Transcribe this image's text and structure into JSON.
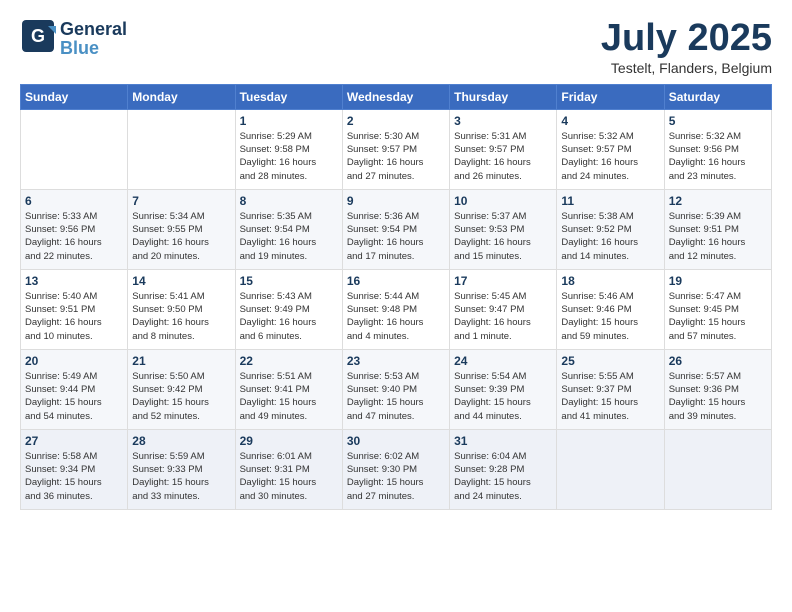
{
  "header": {
    "logo_line1": "General",
    "logo_line2": "Blue",
    "month": "July 2025",
    "location": "Testelt, Flanders, Belgium"
  },
  "weekdays": [
    "Sunday",
    "Monday",
    "Tuesday",
    "Wednesday",
    "Thursday",
    "Friday",
    "Saturday"
  ],
  "weeks": [
    [
      {
        "day": "",
        "info": ""
      },
      {
        "day": "",
        "info": ""
      },
      {
        "day": "1",
        "info": "Sunrise: 5:29 AM\nSunset: 9:58 PM\nDaylight: 16 hours\nand 28 minutes."
      },
      {
        "day": "2",
        "info": "Sunrise: 5:30 AM\nSunset: 9:57 PM\nDaylight: 16 hours\nand 27 minutes."
      },
      {
        "day": "3",
        "info": "Sunrise: 5:31 AM\nSunset: 9:57 PM\nDaylight: 16 hours\nand 26 minutes."
      },
      {
        "day": "4",
        "info": "Sunrise: 5:32 AM\nSunset: 9:57 PM\nDaylight: 16 hours\nand 24 minutes."
      },
      {
        "day": "5",
        "info": "Sunrise: 5:32 AM\nSunset: 9:56 PM\nDaylight: 16 hours\nand 23 minutes."
      }
    ],
    [
      {
        "day": "6",
        "info": "Sunrise: 5:33 AM\nSunset: 9:56 PM\nDaylight: 16 hours\nand 22 minutes."
      },
      {
        "day": "7",
        "info": "Sunrise: 5:34 AM\nSunset: 9:55 PM\nDaylight: 16 hours\nand 20 minutes."
      },
      {
        "day": "8",
        "info": "Sunrise: 5:35 AM\nSunset: 9:54 PM\nDaylight: 16 hours\nand 19 minutes."
      },
      {
        "day": "9",
        "info": "Sunrise: 5:36 AM\nSunset: 9:54 PM\nDaylight: 16 hours\nand 17 minutes."
      },
      {
        "day": "10",
        "info": "Sunrise: 5:37 AM\nSunset: 9:53 PM\nDaylight: 16 hours\nand 15 minutes."
      },
      {
        "day": "11",
        "info": "Sunrise: 5:38 AM\nSunset: 9:52 PM\nDaylight: 16 hours\nand 14 minutes."
      },
      {
        "day": "12",
        "info": "Sunrise: 5:39 AM\nSunset: 9:51 PM\nDaylight: 16 hours\nand 12 minutes."
      }
    ],
    [
      {
        "day": "13",
        "info": "Sunrise: 5:40 AM\nSunset: 9:51 PM\nDaylight: 16 hours\nand 10 minutes."
      },
      {
        "day": "14",
        "info": "Sunrise: 5:41 AM\nSunset: 9:50 PM\nDaylight: 16 hours\nand 8 minutes."
      },
      {
        "day": "15",
        "info": "Sunrise: 5:43 AM\nSunset: 9:49 PM\nDaylight: 16 hours\nand 6 minutes."
      },
      {
        "day": "16",
        "info": "Sunrise: 5:44 AM\nSunset: 9:48 PM\nDaylight: 16 hours\nand 4 minutes."
      },
      {
        "day": "17",
        "info": "Sunrise: 5:45 AM\nSunset: 9:47 PM\nDaylight: 16 hours\nand 1 minute."
      },
      {
        "day": "18",
        "info": "Sunrise: 5:46 AM\nSunset: 9:46 PM\nDaylight: 15 hours\nand 59 minutes."
      },
      {
        "day": "19",
        "info": "Sunrise: 5:47 AM\nSunset: 9:45 PM\nDaylight: 15 hours\nand 57 minutes."
      }
    ],
    [
      {
        "day": "20",
        "info": "Sunrise: 5:49 AM\nSunset: 9:44 PM\nDaylight: 15 hours\nand 54 minutes."
      },
      {
        "day": "21",
        "info": "Sunrise: 5:50 AM\nSunset: 9:42 PM\nDaylight: 15 hours\nand 52 minutes."
      },
      {
        "day": "22",
        "info": "Sunrise: 5:51 AM\nSunset: 9:41 PM\nDaylight: 15 hours\nand 49 minutes."
      },
      {
        "day": "23",
        "info": "Sunrise: 5:53 AM\nSunset: 9:40 PM\nDaylight: 15 hours\nand 47 minutes."
      },
      {
        "day": "24",
        "info": "Sunrise: 5:54 AM\nSunset: 9:39 PM\nDaylight: 15 hours\nand 44 minutes."
      },
      {
        "day": "25",
        "info": "Sunrise: 5:55 AM\nSunset: 9:37 PM\nDaylight: 15 hours\nand 41 minutes."
      },
      {
        "day": "26",
        "info": "Sunrise: 5:57 AM\nSunset: 9:36 PM\nDaylight: 15 hours\nand 39 minutes."
      }
    ],
    [
      {
        "day": "27",
        "info": "Sunrise: 5:58 AM\nSunset: 9:34 PM\nDaylight: 15 hours\nand 36 minutes."
      },
      {
        "day": "28",
        "info": "Sunrise: 5:59 AM\nSunset: 9:33 PM\nDaylight: 15 hours\nand 33 minutes."
      },
      {
        "day": "29",
        "info": "Sunrise: 6:01 AM\nSunset: 9:31 PM\nDaylight: 15 hours\nand 30 minutes."
      },
      {
        "day": "30",
        "info": "Sunrise: 6:02 AM\nSunset: 9:30 PM\nDaylight: 15 hours\nand 27 minutes."
      },
      {
        "day": "31",
        "info": "Sunrise: 6:04 AM\nSunset: 9:28 PM\nDaylight: 15 hours\nand 24 minutes."
      },
      {
        "day": "",
        "info": ""
      },
      {
        "day": "",
        "info": ""
      }
    ]
  ]
}
